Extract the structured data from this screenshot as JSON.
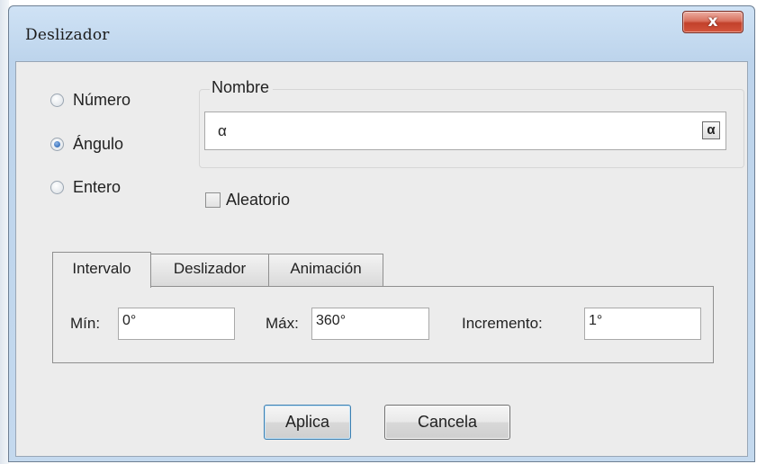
{
  "window": {
    "title": "Deslizador",
    "close_glyph": "x",
    "colors": {
      "titlebar": "#c4d9ee",
      "client": "#ececec",
      "close_button": "#c2412b"
    }
  },
  "type_options": [
    {
      "label": "Número",
      "checked": false
    },
    {
      "label": "Ángulo",
      "checked": true
    },
    {
      "label": "Entero",
      "checked": false
    }
  ],
  "name_group": {
    "legend": "Nombre",
    "value": "α",
    "symbol_button": "α"
  },
  "random_checkbox": {
    "label": "Aleatorio",
    "checked": false
  },
  "tabs": [
    {
      "label": "Intervalo",
      "active": true
    },
    {
      "label": "Deslizador",
      "active": false
    },
    {
      "label": "Animación",
      "active": false
    }
  ],
  "interval": {
    "min_label": "Mín:",
    "min_value": "0°",
    "max_label": "Máx:",
    "max_value": "360°",
    "increment_label": "Incremento:",
    "increment_value": "1°"
  },
  "buttons": {
    "apply": "Aplica",
    "cancel": "Cancela"
  }
}
